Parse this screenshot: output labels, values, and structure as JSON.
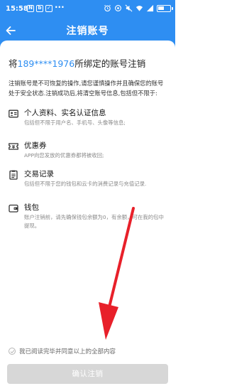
{
  "status_bar": {
    "time": "15:58",
    "left_icons": [
      "N",
      "b",
      "✓"
    ],
    "left_icon_names": [
      "notification-n-icon",
      "notification-b-icon",
      "notification-check-icon"
    ],
    "more": "···",
    "battery_text": "54",
    "battery_level": 0.54
  },
  "header": {
    "title": "注销账号",
    "back_icon": "arrow-left-icon"
  },
  "colors": {
    "brand": "#2e8ef2",
    "button_disabled": "#d7d7d7",
    "arrow": "#e8202a"
  },
  "main": {
    "phone_prefix": "将",
    "phone_number": "189****1976",
    "phone_suffix": "所绑定的账号注销",
    "intro": "注销账号是不可恢复的操作,请您谨慎操作并且确保您的账号处于安全状态.注销成功后,将清空账号信息,包括但不限于:",
    "items": [
      {
        "icon": "id-card-icon",
        "title": "个人资料、实名认证信息",
        "desc": "包括但不限于用户名、手机号、头像等信息;"
      },
      {
        "icon": "coupon-icon",
        "title": "优惠券",
        "desc": "APP向您发放的优惠券都将被收回;"
      },
      {
        "icon": "document-list-icon",
        "title": "交易记录",
        "desc": "包括但不限于您的钱包和云卡的消费记录与充值记录."
      },
      {
        "icon": "wallet-icon",
        "title": "钱包",
        "desc": "账户注销前，请先确保钱包余额为0，有余额，可在我的包中提现。"
      }
    ]
  },
  "footer": {
    "agree_label": "我已阅读完毕并同意以上的全部内容",
    "confirm_label": "确认注销"
  }
}
